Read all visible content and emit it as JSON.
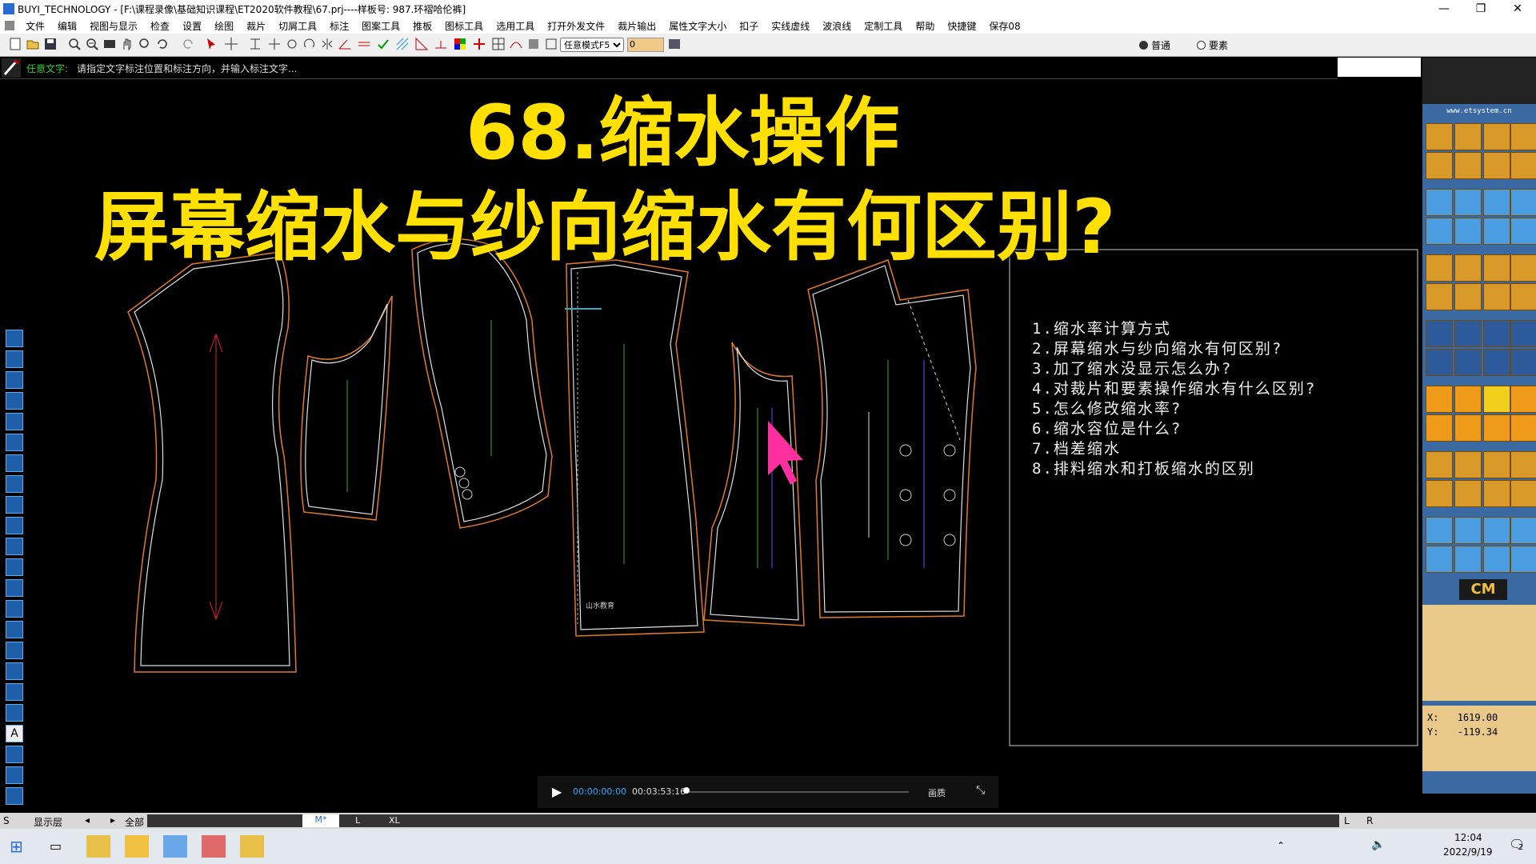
{
  "window": {
    "title": "BUYI_TECHNOLOGY - [F:\\课程录像\\基础知识课程\\ET2020软件教程\\67.prj----样板号: 987.环褶哈伦裤]",
    "minimize": "—",
    "restore": "❐",
    "close": "✕"
  },
  "menu": [
    "文件",
    "编辑",
    "视图与显示",
    "检查",
    "设置",
    "绘图",
    "裁片",
    "切屑工具",
    "标注",
    "图案工具",
    "推板",
    "图标工具",
    "选用工具",
    "打开外发文件",
    "裁片输出",
    "属性文字大小",
    "扣子",
    "实线虚线",
    "波浪线",
    "定制工具",
    "帮助",
    "快捷键",
    "保存08"
  ],
  "toolbar": {
    "mode_select": "任意模式F5",
    "number_input": "0",
    "radio_normal": "普通",
    "radio_element": "要素"
  },
  "prompt": {
    "label": "任意文字:",
    "text": "请指定文字标注位置和标注方向，并输入标注文字..."
  },
  "headline": {
    "line1": "68.缩水操作",
    "line2": "屏幕缩水与纱向缩水有何区别?"
  },
  "notes": [
    "1.缩水率计算方式",
    "2.屏幕缩水与纱向缩水有何区别?",
    "3.加了缩水没显示怎么办?",
    "4.对裁片和要素操作缩水有什么区别?",
    "5.怎么修改缩水率?",
    "6.缩水容位是什么?",
    "7.档差缩水",
    "8.排料缩水和打板缩水的区别"
  ],
  "pattern_label": "山水教育",
  "right_panel": {
    "site": "www.etsystem.cn",
    "unit": "CM",
    "coord_x_label": "X:",
    "coord_x": "1619.00",
    "coord_y_label": "Y:",
    "coord_y": "-119.34"
  },
  "video": {
    "current": "00:00:00:00",
    "duration": "00:03:53:16",
    "quality": "画质",
    "progress": 0.0
  },
  "status": {
    "s": "S",
    "layer": "显示层",
    "all": "全部",
    "size_m": "M*",
    "size_l": "L",
    "size_xl": "XL",
    "left": "L",
    "right": "R"
  },
  "tray": {
    "time": "12:04",
    "date": "2022/9/19",
    "notif": "2"
  },
  "colors": {
    "headline": "#ffe000",
    "pattern_outline": "#e0e0e0",
    "seam_allowance": "#e07a2a",
    "grain_line": "#2fa82f",
    "cursor": "#ff2fa0",
    "right_panel": "#3b6aa3"
  }
}
